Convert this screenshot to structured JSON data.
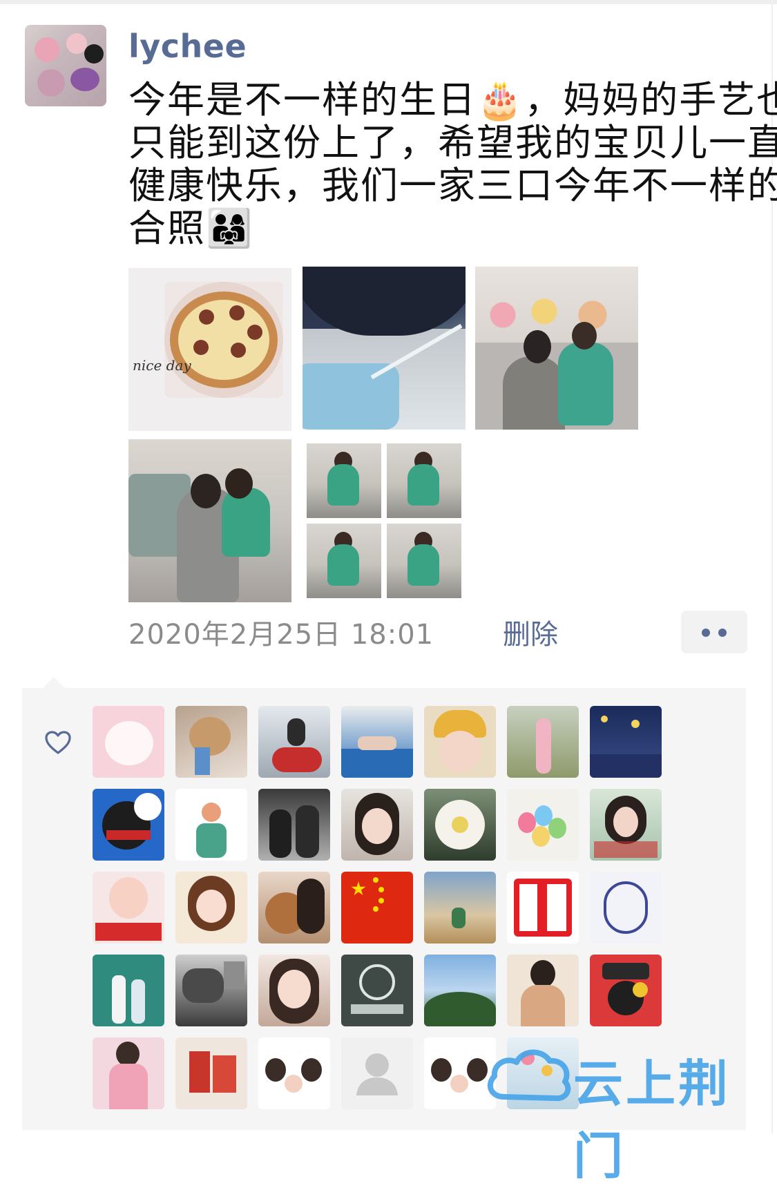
{
  "post": {
    "username": "lychee",
    "text_lines": [
      "今年是不一样的生日🎂，妈妈的手艺也",
      "只能到这份上了，希望我的宝贝儿一直",
      "健康快乐，我们一家三口今年不一样的",
      "合照👨‍👩‍👧"
    ],
    "photo_note": "nice day",
    "timestamp": "2020年2月25日 18:01",
    "delete_label": "删除"
  },
  "likes": {
    "icon": "heart-icon",
    "count_rows": 5
  },
  "colors": {
    "link": "#576b95",
    "meta_gray": "#8b8b8b",
    "panel_bg": "#f5f5f5"
  },
  "watermark": {
    "text": "云上荆门"
  }
}
